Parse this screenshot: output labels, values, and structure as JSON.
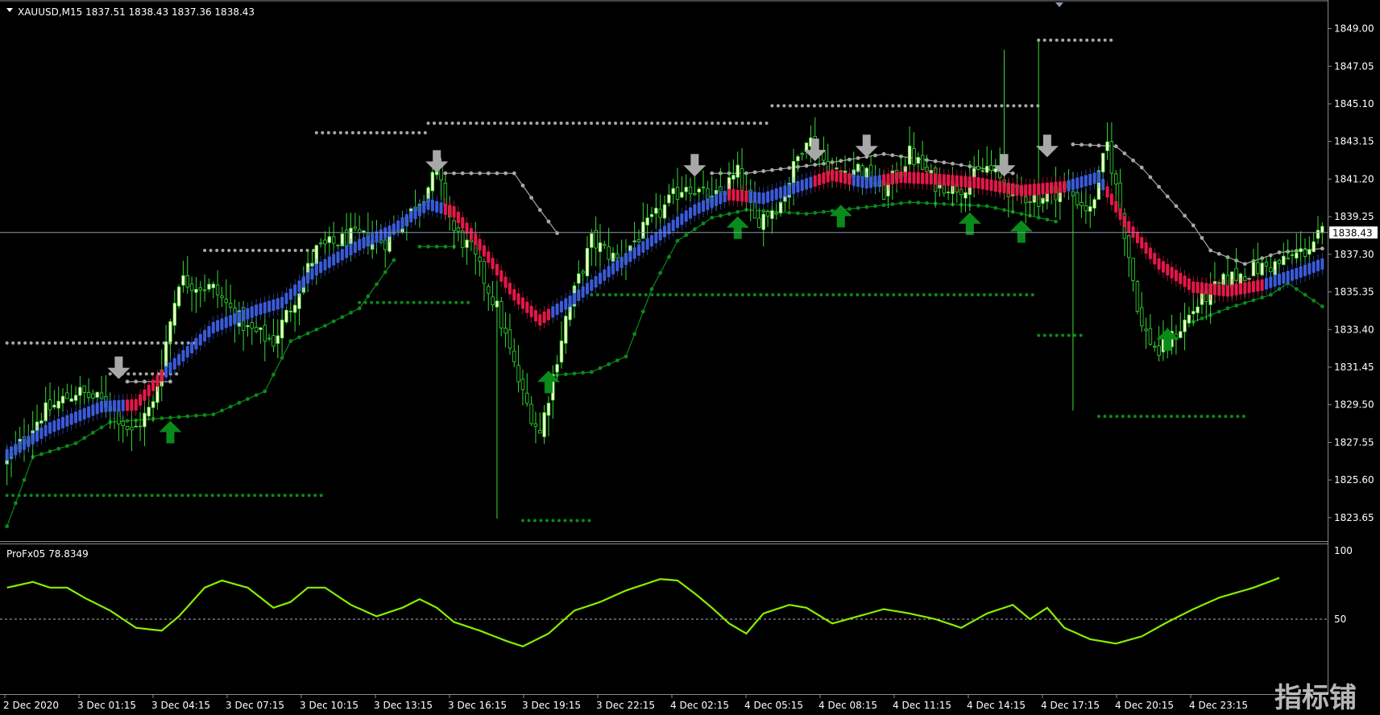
{
  "window": {
    "title": "XAUUSD,M15  1837.51 1838.43 1837.36 1838.43",
    "indicator_title": "ProFx05 78.8349",
    "current_price_label": "1838.43",
    "watermark": "指标铺"
  },
  "colors": {
    "background": "#000000",
    "grid_line": "#8899aa",
    "candle_up": "#ffffcc",
    "candle_down": "#000000",
    "wick": "#33dd33",
    "trend_up": "#3b5bdb",
    "trend_down": "#e8174a",
    "support_dots": "#0a8a1a",
    "resistance_dots": "#a8a8a8",
    "arrow_up": "#0a8a1a",
    "arrow_down": "#a8a8a8",
    "oscillator": "#88ee00"
  },
  "icons": {
    "arrow_up": "arrow-up-icon",
    "arrow_down": "arrow-down-icon"
  },
  "chart_data": [
    {
      "type": "candlestick",
      "title": "XAUUSD,M15  1837.51 1838.43 1837.36 1838.43",
      "ylim": [
        1822.6,
        1849.9
      ],
      "y_ticks": [
        "1849.00",
        "1847.05",
        "1845.10",
        "1843.15",
        "1841.20",
        "1839.25",
        "1837.30",
        "1835.35",
        "1833.40",
        "1831.45",
        "1829.50",
        "1827.55",
        "1825.60",
        "1823.65"
      ],
      "x_ticks": [
        "2 Dec 2020",
        "3 Dec 01:15",
        "3 Dec 04:15",
        "3 Dec 07:15",
        "3 Dec 10:15",
        "3 Dec 13:15",
        "3 Dec 16:15",
        "3 Dec 19:15",
        "3 Dec 22:15",
        "4 Dec 02:15",
        "4 Dec 05:15",
        "4 Dec 08:15",
        "4 Dec 11:15",
        "4 Dec 14:15",
        "4 Dec 17:15",
        "4 Dec 20:15",
        "4 Dec 23:15"
      ],
      "last_price": 1838.43,
      "close_keypoints": [
        [
          0,
          1826.5
        ],
        [
          8,
          1829.0
        ],
        [
          16,
          1830.2
        ],
        [
          24,
          1829.5
        ],
        [
          29,
          1828.0
        ],
        [
          34,
          1829.5
        ],
        [
          40,
          1836.0
        ],
        [
          48,
          1835.5
        ],
        [
          56,
          1833.4
        ],
        [
          62,
          1832.8
        ],
        [
          66,
          1834.6
        ],
        [
          72,
          1837.5
        ],
        [
          80,
          1838.2
        ],
        [
          88,
          1838.0
        ],
        [
          94,
          1839.5
        ],
        [
          100,
          1841.5
        ],
        [
          104,
          1838.5
        ],
        [
          108,
          1837.5
        ],
        [
          114,
          1834.5
        ],
        [
          120,
          1830.0
        ],
        [
          124,
          1828.0
        ],
        [
          130,
          1834.0
        ],
        [
          136,
          1838.0
        ],
        [
          142,
          1837.0
        ],
        [
          150,
          1839.0
        ],
        [
          158,
          1841.0
        ],
        [
          164,
          1840.0
        ],
        [
          170,
          1841.5
        ],
        [
          174,
          1839.0
        ],
        [
          180,
          1840.0
        ],
        [
          186,
          1843.5
        ],
        [
          192,
          1841.5
        ],
        [
          198,
          1841.8
        ],
        [
          204,
          1840.5
        ],
        [
          210,
          1842.5
        ],
        [
          216,
          1841.0
        ],
        [
          222,
          1840.8
        ],
        [
          228,
          1841.8
        ],
        [
          234,
          1840.5
        ],
        [
          240,
          1840.2
        ],
        [
          246,
          1840.8
        ],
        [
          252,
          1839.5
        ],
        [
          256,
          1843.0
        ],
        [
          260,
          1838.5
        ],
        [
          264,
          1833.5
        ],
        [
          268,
          1832.2
        ],
        [
          272,
          1833.2
        ],
        [
          278,
          1835.0
        ],
        [
          284,
          1836.0
        ],
        [
          290,
          1836.5
        ],
        [
          296,
          1836.8
        ],
        [
          302,
          1837.5
        ],
        [
          306,
          1838.43
        ]
      ],
      "trend_line": [
        [
          0,
          1826.9
        ],
        [
          10,
          1828.3
        ],
        [
          22,
          1829.4
        ],
        [
          30,
          1829.5
        ],
        [
          36,
          1831.0
        ],
        [
          48,
          1833.5
        ],
        [
          58,
          1834.4
        ],
        [
          64,
          1834.8
        ],
        [
          72,
          1836.5
        ],
        [
          82,
          1837.8
        ],
        [
          90,
          1838.6
        ],
        [
          98,
          1839.9
        ],
        [
          104,
          1839.5
        ],
        [
          110,
          1837.8
        ],
        [
          118,
          1835.2
        ],
        [
          124,
          1833.9
        ],
        [
          132,
          1835.0
        ],
        [
          140,
          1836.4
        ],
        [
          150,
          1838.0
        ],
        [
          160,
          1839.6
        ],
        [
          168,
          1840.4
        ],
        [
          176,
          1840.2
        ],
        [
          184,
          1840.8
        ],
        [
          192,
          1841.4
        ],
        [
          200,
          1841.0
        ],
        [
          208,
          1841.3
        ],
        [
          216,
          1841.2
        ],
        [
          226,
          1841.0
        ],
        [
          236,
          1840.6
        ],
        [
          246,
          1840.8
        ],
        [
          254,
          1841.3
        ],
        [
          260,
          1839.0
        ],
        [
          268,
          1836.8
        ],
        [
          276,
          1835.6
        ],
        [
          284,
          1835.4
        ],
        [
          292,
          1835.7
        ],
        [
          300,
          1836.3
        ],
        [
          306,
          1836.8
        ]
      ],
      "trend_down_segments": [
        [
          28,
          36
        ],
        [
          102,
          126
        ],
        [
          168,
          172
        ],
        [
          188,
          196
        ],
        [
          204,
          246
        ],
        [
          256,
          292
        ]
      ],
      "support_levels": [
        {
          "from": 0,
          "to": 74,
          "y": 1824.8
        },
        {
          "from": 82,
          "to": 108,
          "y": 1834.8
        },
        {
          "from": 120,
          "to": 136,
          "y": 1823.5
        },
        {
          "from": 136,
          "to": 240,
          "y": 1835.2
        },
        {
          "from": 240,
          "to": 250,
          "y": 1833.1
        },
        {
          "from": 254,
          "to": 288,
          "y": 1828.9
        }
      ],
      "resistance_levels": [
        {
          "from": 0,
          "to": 46,
          "y": 1832.7
        },
        {
          "from": 24,
          "to": 40,
          "y": 1831.1
        },
        {
          "from": 46,
          "to": 72,
          "y": 1837.5
        },
        {
          "from": 72,
          "to": 98,
          "y": 1843.6
        },
        {
          "from": 98,
          "to": 178,
          "y": 1844.1
        },
        {
          "from": 178,
          "to": 240,
          "y": 1845.0
        },
        {
          "from": 240,
          "to": 258,
          "y": 1848.4
        }
      ],
      "support_trail": [
        [
          0,
          1823.2
        ],
        [
          6,
          1826.8
        ],
        [
          16,
          1827.5
        ],
        [
          24,
          1828.6
        ],
        [
          36,
          1828.8
        ],
        [
          48,
          1829.0
        ],
        [
          60,
          1830.2
        ],
        [
          66,
          1832.8
        ],
        [
          74,
          1833.6
        ],
        [
          82,
          1834.5
        ],
        [
          90,
          1837.0
        ],
        [
          96,
          1837.7
        ],
        [
          104,
          1837.7
        ],
        [
          126,
          1831.0
        ],
        [
          136,
          1831.2
        ],
        [
          144,
          1832.0
        ],
        [
          150,
          1835.5
        ],
        [
          156,
          1838.0
        ],
        [
          164,
          1839.2
        ],
        [
          172,
          1839.6
        ],
        [
          186,
          1839.4
        ],
        [
          198,
          1839.7
        ],
        [
          210,
          1840.0
        ],
        [
          228,
          1839.8
        ],
        [
          236,
          1839.4
        ],
        [
          244,
          1839.0
        ],
        [
          276,
          1833.8
        ],
        [
          284,
          1834.5
        ],
        [
          294,
          1835.2
        ],
        [
          298,
          1835.8
        ],
        [
          306,
          1834.6
        ]
      ],
      "resistance_trail": [
        [
          28,
          1830.7
        ],
        [
          38,
          1830.7
        ],
        [
          102,
          1841.5
        ],
        [
          118,
          1841.5
        ],
        [
          124,
          1839.6
        ],
        [
          128,
          1838.4
        ],
        [
          164,
          1841.5
        ],
        [
          172,
          1841.5
        ],
        [
          190,
          1842.0
        ],
        [
          204,
          1842.5
        ],
        [
          220,
          1842.0
        ],
        [
          234,
          1841.5
        ],
        [
          248,
          1843.0
        ],
        [
          258,
          1842.9
        ],
        [
          264,
          1841.8
        ],
        [
          270,
          1840.3
        ],
        [
          276,
          1838.8
        ],
        [
          280,
          1837.5
        ],
        [
          288,
          1836.8
        ],
        [
          296,
          1837.4
        ],
        [
          306,
          1837.6
        ]
      ],
      "buy_arrows": [
        {
          "bar": 38,
          "price": 1828.0
        },
        {
          "bar": 126,
          "price": 1830.6
        },
        {
          "bar": 170,
          "price": 1838.6
        },
        {
          "bar": 194,
          "price": 1839.2
        },
        {
          "bar": 224,
          "price": 1838.8
        },
        {
          "bar": 236,
          "price": 1838.4
        },
        {
          "bar": 270,
          "price": 1832.8
        }
      ],
      "sell_arrows": [
        {
          "bar": 26,
          "price": 1831.5
        },
        {
          "bar": 100,
          "price": 1842.2
        },
        {
          "bar": 160,
          "price": 1842.0
        },
        {
          "bar": 188,
          "price": 1842.8
        },
        {
          "bar": 200,
          "price": 1843.0
        },
        {
          "bar": 232,
          "price": 1842.0
        },
        {
          "bar": 242,
          "price": 1843.0
        }
      ],
      "spikes": [
        {
          "bar": 114,
          "low": 1823.6
        },
        {
          "bar": 232,
          "high": 1847.9
        },
        {
          "bar": 240,
          "high": 1848.4
        },
        {
          "bar": 248,
          "low": 1829.2
        }
      ]
    },
    {
      "type": "line",
      "title": "ProFx05 78.8349",
      "name": "ProFx05",
      "last_value": 78.8349,
      "ylim": [
        0,
        100
      ],
      "y_ticks": [
        "100",
        "50"
      ],
      "level": 50,
      "keypoints": [
        [
          0,
          72
        ],
        [
          6,
          76
        ],
        [
          10,
          72
        ],
        [
          14,
          72
        ],
        [
          18,
          65
        ],
        [
          24,
          56
        ],
        [
          30,
          44
        ],
        [
          36,
          42
        ],
        [
          40,
          52
        ],
        [
          46,
          72
        ],
        [
          50,
          77
        ],
        [
          56,
          72
        ],
        [
          62,
          58
        ],
        [
          66,
          62
        ],
        [
          70,
          72
        ],
        [
          74,
          72
        ],
        [
          80,
          60
        ],
        [
          86,
          52
        ],
        [
          92,
          58
        ],
        [
          96,
          64
        ],
        [
          100,
          58
        ],
        [
          104,
          48
        ],
        [
          110,
          42
        ],
        [
          116,
          35
        ],
        [
          120,
          31
        ],
        [
          126,
          40
        ],
        [
          132,
          56
        ],
        [
          138,
          62
        ],
        [
          144,
          70
        ],
        [
          148,
          74
        ],
        [
          152,
          78
        ],
        [
          156,
          77
        ],
        [
          160,
          68
        ],
        [
          164,
          58
        ],
        [
          168,
          47
        ],
        [
          172,
          40
        ],
        [
          176,
          54
        ],
        [
          182,
          60
        ],
        [
          186,
          58
        ],
        [
          192,
          47
        ],
        [
          198,
          52
        ],
        [
          204,
          57
        ],
        [
          210,
          54
        ],
        [
          216,
          50
        ],
        [
          222,
          44
        ],
        [
          228,
          54
        ],
        [
          234,
          60
        ],
        [
          238,
          50
        ],
        [
          242,
          58
        ],
        [
          246,
          44
        ],
        [
          252,
          36
        ],
        [
          258,
          33
        ],
        [
          264,
          38
        ],
        [
          270,
          48
        ],
        [
          276,
          57
        ],
        [
          282,
          65
        ],
        [
          290,
          72
        ],
        [
          296,
          78.8
        ]
      ]
    }
  ]
}
